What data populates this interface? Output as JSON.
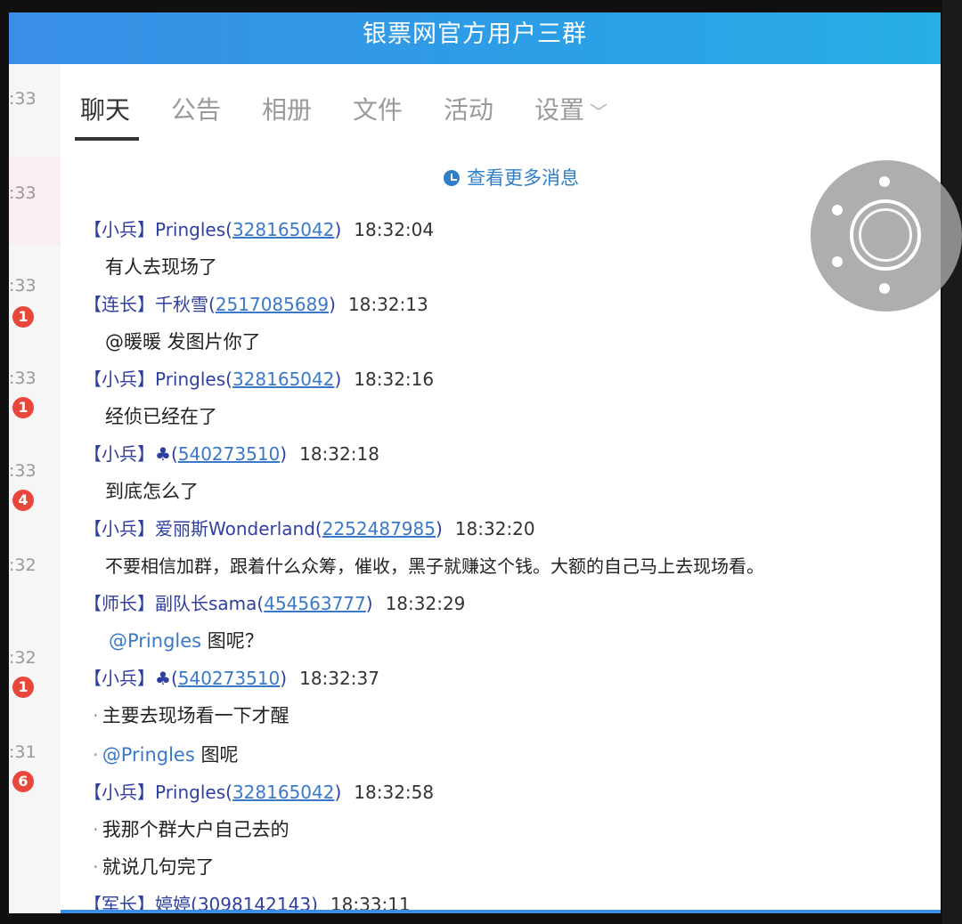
{
  "window": {
    "title": "银票网官方用户三群"
  },
  "tabs": [
    {
      "label": "聊天"
    },
    {
      "label": "公告"
    },
    {
      "label": "相册"
    },
    {
      "label": "文件"
    },
    {
      "label": "活动"
    },
    {
      "label": "设置"
    }
  ],
  "conversation_list": {
    "times": [
      ":33",
      ":33",
      ":33",
      ":33",
      ":33",
      ":32",
      ":32",
      ":31"
    ],
    "badges": [
      "1",
      "1",
      "4",
      "1",
      "6"
    ]
  },
  "more_messages": "查看更多消息",
  "messages": [
    {
      "rank": "【小兵】",
      "name": "Pringles",
      "uid": "328165042",
      "time": "18:32:04",
      "lines": [
        "有人去现场了"
      ]
    },
    {
      "rank": "【连长】",
      "name": "千秋雪",
      "uid": "2517085689",
      "time": "18:32:13",
      "lines": [
        "@暖暖 发图片你了"
      ]
    },
    {
      "rank": "【小兵】",
      "name": "Pringles",
      "uid": "328165042",
      "time": "18:32:16",
      "lines": [
        "经侦已经在了"
      ]
    },
    {
      "rank": "【小兵】",
      "name": "♣",
      "uid": "540273510",
      "time": "18:32:18",
      "lines": [
        "到底怎么了"
      ]
    },
    {
      "rank": "【小兵】",
      "name": "爱丽斯Wonderland",
      "uid": "2252487985",
      "time": "18:32:20",
      "lines": [
        "不要相信加群，跟着什么众筹，催收，黑子就赚这个钱。大额的自己马上去现场看。"
      ]
    },
    {
      "rank": "【师长】",
      "name": "副队长sama",
      "uid": "454563777",
      "time": "18:32:29",
      "lines": [
        {
          "mention": "@Pringles",
          "text": "图呢？"
        }
      ]
    },
    {
      "rank": "【小兵】",
      "name": "♣",
      "uid": "540273510",
      "time": "18:32:37",
      "lines": [
        "主要去现场看一下才醒",
        {
          "mention": "@Pringles",
          "text": "图呢"
        }
      ]
    },
    {
      "rank": "【小兵】",
      "name": "Pringles",
      "uid": "328165042",
      "time": "18:32:58",
      "lines": [
        "我那个群大户自己去的",
        "就说几句完了"
      ]
    },
    {
      "rank": "【军长】",
      "name": "婷婷",
      "uid": "3098142143",
      "time": "18:33:11",
      "lines": []
    }
  ]
}
